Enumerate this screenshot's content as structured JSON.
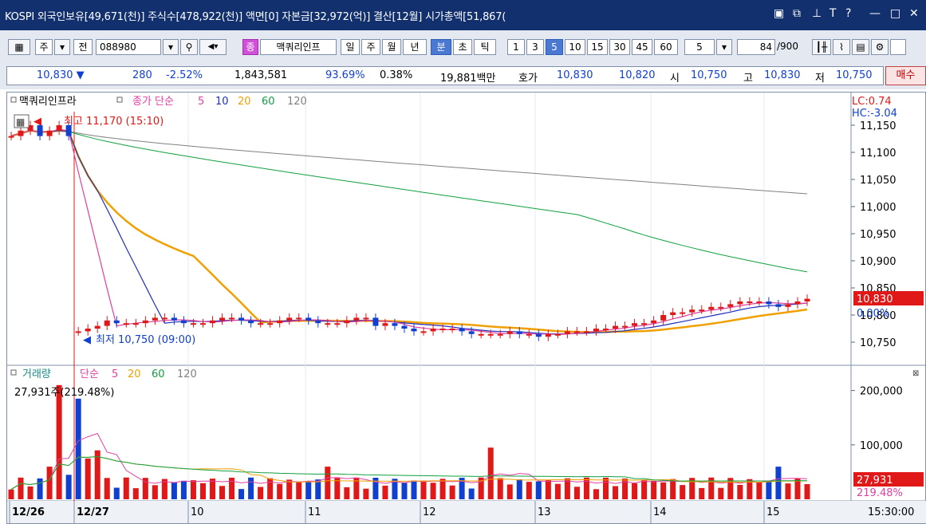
{
  "titlebar": {
    "text": "KOSPI 외국인보유[49,671(천)] 주식수[478,922(천)] 액면[0] 자본금[32,972(억)] 결산[12월] 시가총액[51,867(",
    "icons": [
      "restore-icon",
      "window-icon",
      "pin-icon",
      "font-icon",
      "help-icon",
      "minimize-icon",
      "maximize-icon",
      "close-icon"
    ],
    "icon_glyphs": [
      "▣",
      "⧉",
      "⊥",
      "T",
      "?",
      "—",
      "□",
      "✕"
    ]
  },
  "toolbar": {
    "market": "주",
    "all_label": "전",
    "code": "088980",
    "search_glyph": "🔍",
    "sound_glyph": "◀·",
    "badge": "종",
    "name": "맥쿼리인프",
    "periods": [
      "일",
      "주",
      "월",
      "년",
      "분",
      "초",
      "틱"
    ],
    "selected_period": "분",
    "intervals": [
      "1",
      "3",
      "5",
      "10",
      "15",
      "30",
      "45",
      "60"
    ],
    "selected_interval": "5",
    "count_select": "5",
    "count": "84",
    "count_total": "/900"
  },
  "quote": {
    "price": "10,830",
    "change": "280",
    "change_pct": "-2.52%",
    "volume": "1,843,581",
    "ratio1": "93.69%",
    "ratio2": "0.38%",
    "amount": "19,881백만",
    "ask_label": "호가",
    "ask": "10,830",
    "bid": "10,820",
    "open_label": "시",
    "open": "10,750",
    "high_label": "고",
    "high": "10,830",
    "low_label": "저",
    "low": "10,750",
    "buy_label": "매수"
  },
  "price_legend": {
    "name": "맥쿼리인프라",
    "ma_label": "종가 단순",
    "ma_periods": [
      "5",
      "10",
      "20",
      "60",
      "120"
    ],
    "ma_colors": [
      "#e040a0",
      "#2030c0",
      "#f0a000",
      "#10a040",
      "#808080"
    ],
    "lc": "LC:0.74",
    "hc": "HC:-3.04",
    "max_label": "최고 11,170 (15:10)",
    "min_label": "최저 10,750 (09:00)",
    "current_price": "10,830",
    "current_pct": "0.00%"
  },
  "volume_legend": {
    "name": "거래량",
    "ma_label": "단순",
    "ma_periods": [
      "5",
      "20",
      "60",
      "120"
    ],
    "readout": "27,931주(219.48%)",
    "current": "27,931",
    "current_pct": "219.48%"
  },
  "axes": {
    "price_ticks": [
      "11,150",
      "11,100",
      "11,050",
      "11,000",
      "10,950",
      "10,900",
      "10,850",
      "10,800",
      "10,750"
    ],
    "volume_ticks": [
      "200,000",
      "100,000"
    ],
    "date_labels": [
      "12/26",
      "12/27",
      "10",
      "11",
      "12",
      "13",
      "14",
      "15"
    ],
    "time_label": "15:30:00"
  },
  "chart_data": {
    "type": "line",
    "price_range": [
      10725,
      11175
    ],
    "volume_range": [
      0,
      220000
    ],
    "colors": {
      "up": "#e01818",
      "down": "#1040d0"
    }
  }
}
